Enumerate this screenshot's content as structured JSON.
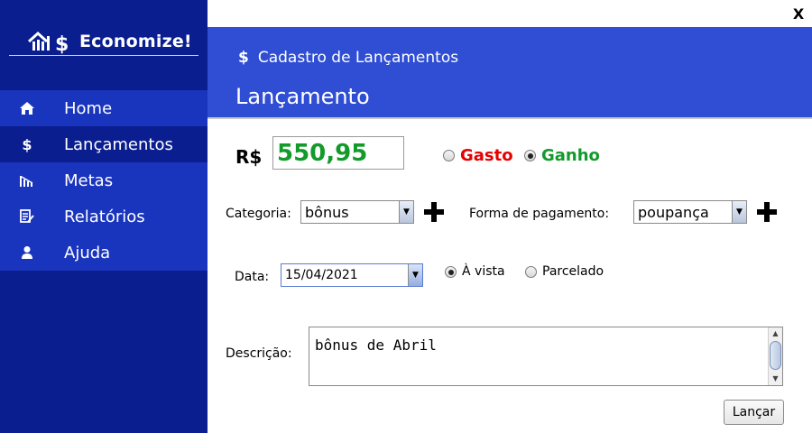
{
  "window": {
    "close_label": "X"
  },
  "sidebar": {
    "brand": "Economize!",
    "items": [
      {
        "label": "Home",
        "icon": "home-icon"
      },
      {
        "label": "Lançamentos",
        "icon": "dollar-icon"
      },
      {
        "label": "Metas",
        "icon": "bar-chart-icon"
      },
      {
        "label": "Relatórios",
        "icon": "report-icon"
      },
      {
        "label": "Ajuda",
        "icon": "user-icon"
      }
    ],
    "active_item": "Lançamentos"
  },
  "header": {
    "icon_symbol": "$",
    "subtitle": "Cadastro de Lançamentos",
    "title": "Lançamento"
  },
  "form": {
    "currency_label": "R$",
    "amount": "550,95",
    "type_options": [
      {
        "label": "Gasto",
        "selected": false,
        "color": "#e60000"
      },
      {
        "label": "Ganho",
        "selected": true,
        "color": "#129a2a"
      }
    ],
    "category_label": "Categoria:",
    "category_value": "bônus",
    "payment_label": "Forma de pagamento:",
    "payment_value": "poupança",
    "date_label": "Data:",
    "date_value": "15/04/2021",
    "payment_mode_options": [
      {
        "label": "À vista",
        "selected": true
      },
      {
        "label": "Parcelado",
        "selected": false
      }
    ],
    "description_label": "Descrição:",
    "description_value": "bônus de Abril",
    "submit_label": "Lançar"
  },
  "colors": {
    "sidebar_bg": "#0b1e8f",
    "nav_item_bg": "#1a35bd",
    "header_bg": "#2f4ed3",
    "amount_text": "#129a2a"
  }
}
